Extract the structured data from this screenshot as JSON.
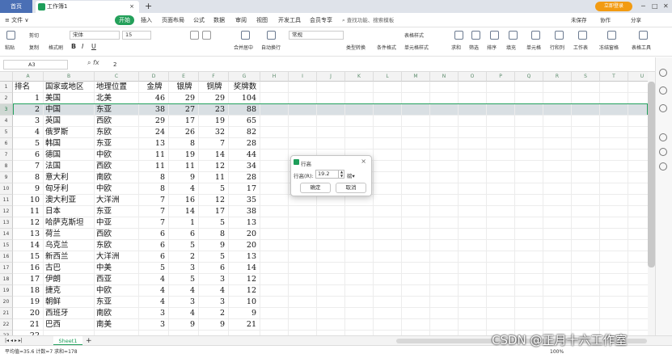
{
  "tabs": {
    "home": "首页",
    "doc": "工作簿1",
    "close": "×",
    "new": "+"
  },
  "header": {
    "login": "立即登录"
  },
  "menus": [
    "≡ 文件 ∨",
    "开始",
    "插入",
    "页面布局",
    "公式",
    "数据",
    "审阅",
    "视图",
    "开发工具",
    "会员专享"
  ],
  "search_placeholder": "查找功能、搜索模板",
  "right_menu": [
    "未保存",
    "协作",
    "分享"
  ],
  "ribbon": {
    "paste": "粘贴",
    "cut": "剪切",
    "copy": "复制",
    "format_painter": "格式刷",
    "font": "宋体",
    "size": "15",
    "bold": "B",
    "italic": "I",
    "underline": "U",
    "merge": "合并居中",
    "wrap": "自动换行",
    "numfmt": "常规",
    "type_convert": "类型转换",
    "cond_fmt": "条件格式",
    "table_style": "表格样式",
    "cell_style": "单元格样式",
    "sum": "求和",
    "filter": "筛选",
    "sort": "排序",
    "fill": "填充",
    "cell": "单元格",
    "rowcol": "行和列",
    "sheet": "工作表",
    "freeze": "冻结窗格",
    "tools": "表格工具"
  },
  "formula_bar": {
    "cell_ref": "A3",
    "fx": "fx",
    "value": "2"
  },
  "columns": [
    "A",
    "B",
    "C",
    "D",
    "E",
    "F",
    "G",
    "H",
    "I",
    "J",
    "K",
    "L",
    "M",
    "N",
    "O",
    "P",
    "Q",
    "R",
    "S",
    "T",
    "U"
  ],
  "row_numbers": [
    "1",
    "2",
    "3",
    "4",
    "5",
    "6",
    "7",
    "8",
    "9",
    "10",
    "11",
    "12",
    "13",
    "14",
    "15",
    "16",
    "17",
    "18",
    "19",
    "20",
    "21",
    "22",
    "23"
  ],
  "rows": [
    [
      "排名",
      "国家或地区",
      "地理位置",
      "金牌",
      "银牌",
      "铜牌",
      "奖牌数"
    ],
    [
      "1",
      "美国",
      "北美",
      "46",
      "29",
      "29",
      "104"
    ],
    [
      "2",
      "中国",
      "东亚",
      "38",
      "27",
      "23",
      "88"
    ],
    [
      "3",
      "英国",
      "西欧",
      "29",
      "17",
      "19",
      "65"
    ],
    [
      "4",
      "俄罗斯",
      "东欧",
      "24",
      "26",
      "32",
      "82"
    ],
    [
      "5",
      "韩国",
      "东亚",
      "13",
      "8",
      "7",
      "28"
    ],
    [
      "6",
      "德国",
      "中欧",
      "11",
      "19",
      "14",
      "44"
    ],
    [
      "7",
      "法国",
      "西欧",
      "11",
      "11",
      "12",
      "34"
    ],
    [
      "8",
      "意大利",
      "南欧",
      "8",
      "9",
      "11",
      "28"
    ],
    [
      "9",
      "匈牙利",
      "中欧",
      "8",
      "4",
      "5",
      "17"
    ],
    [
      "10",
      "澳大利亚",
      "大洋洲",
      "7",
      "16",
      "12",
      "35"
    ],
    [
      "11",
      "日本",
      "东亚",
      "7",
      "14",
      "17",
      "38"
    ],
    [
      "12",
      "哈萨克斯坦",
      "中亚",
      "7",
      "1",
      "5",
      "13"
    ],
    [
      "13",
      "荷兰",
      "西欧",
      "6",
      "6",
      "8",
      "20"
    ],
    [
      "14",
      "乌克兰",
      "东欧",
      "6",
      "5",
      "9",
      "20"
    ],
    [
      "15",
      "新西兰",
      "大洋洲",
      "6",
      "2",
      "5",
      "13"
    ],
    [
      "16",
      "古巴",
      "中美",
      "5",
      "3",
      "6",
      "14"
    ],
    [
      "17",
      "伊朗",
      "西亚",
      "4",
      "5",
      "3",
      "12"
    ],
    [
      "18",
      "捷克",
      "中欧",
      "4",
      "4",
      "4",
      "12"
    ],
    [
      "19",
      "朝鲜",
      "东亚",
      "4",
      "3",
      "3",
      "10"
    ],
    [
      "20",
      "西班牙",
      "南欧",
      "3",
      "4",
      "2",
      "9"
    ],
    [
      "21",
      "巴西",
      "南美",
      "3",
      "9",
      "9",
      "21"
    ],
    [
      "22",
      "",
      "",
      "",
      "",
      "",
      ""
    ]
  ],
  "selected_row": "3",
  "sheet_tab": "Sheet1",
  "status": {
    "summary": "平均值=35.6  计数=7  求和=178",
    "zoom": "100%"
  },
  "dialog": {
    "title": "行高",
    "label": "行高(R):",
    "value": "19.2",
    "unit": "磅▾",
    "ok": "确定",
    "cancel": "取消",
    "close": "×"
  },
  "watermark": "CSDN @正月十六工作室"
}
